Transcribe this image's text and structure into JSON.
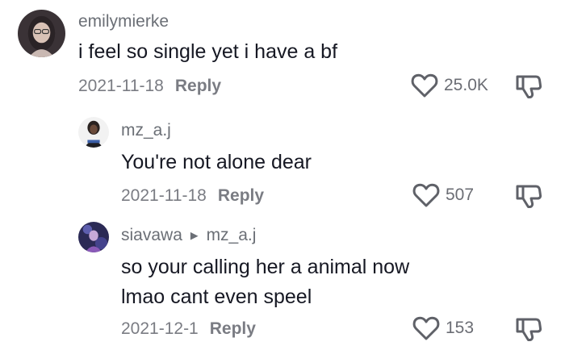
{
  "comments": [
    {
      "username": "emilymierke",
      "text_lines": [
        "i feel so single yet i have a bf"
      ],
      "date": "2021-11-18",
      "reply_label": "Reply",
      "likes": "25.0K"
    },
    {
      "username": "mz_a.j",
      "text_lines": [
        "You're not alone dear"
      ],
      "date": "2021-11-18",
      "reply_label": "Reply",
      "likes": "507"
    },
    {
      "username": "siavawa",
      "reply_to": "mz_a.j",
      "text_lines": [
        "so your calling her a animal now",
        "lmao cant even speel"
      ],
      "date": "2021-12-1",
      "reply_label": "Reply",
      "likes": "153"
    }
  ],
  "icons": {
    "like": "heart-outline-icon",
    "dislike": "thumbs-down-outline-icon",
    "reply_arrow": "triangle-right-icon"
  },
  "colors": {
    "username": "#6b6f76",
    "text": "#161823",
    "meta": "#7a7c83",
    "icon": "#5f6168"
  }
}
